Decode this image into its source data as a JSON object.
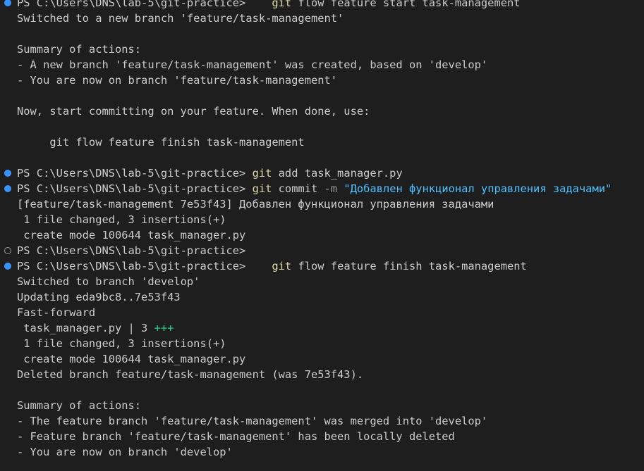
{
  "theme": {
    "background": "#1e1e1e",
    "text": "#cccccc",
    "command_color": "#dcdcaa",
    "string_color": "#4fc1ff",
    "success_dot": "#3794ff",
    "plus_color": "#23d18b"
  },
  "icons": {
    "success": "command-success-dot-icon",
    "empty": "command-empty-dot-icon"
  },
  "terminal": {
    "lines": [
      {
        "dot": "success",
        "prompt": "PS C:\\Users\\DNS\\lab-5\\git-practice> ",
        "gap": "   ",
        "cmd": "git",
        "args": " flow feature start task-management"
      },
      {
        "text": "Switched to a new branch 'feature/task-management'"
      },
      {
        "text": ""
      },
      {
        "text": "Summary of actions:"
      },
      {
        "text": "- A new branch 'feature/task-management' was created, based on 'develop'"
      },
      {
        "text": "- You are now on branch 'feature/task-management'"
      },
      {
        "text": ""
      },
      {
        "text": "Now, start committing on your feature. When done, use:"
      },
      {
        "text": ""
      },
      {
        "text": "     git flow feature finish task-management"
      },
      {
        "text": ""
      },
      {
        "dot": "success",
        "prompt": "PS C:\\Users\\DNS\\lab-5\\git-practice> ",
        "gap": "",
        "cmd": "git",
        "args": " add task_manager.py"
      },
      {
        "dot": "success",
        "prompt": "PS C:\\Users\\DNS\\lab-5\\git-practice> ",
        "gap": "",
        "cmd": "git",
        "args": " commit ",
        "flag": "-m",
        "str": " \"Добавлен функционал управления задачами\""
      },
      {
        "text": "[feature/task-management 7e53f43] Добавлен функционал управления задачами"
      },
      {
        "text": " 1 file changed, 3 insertions(+)"
      },
      {
        "text": " create mode 100644 task_manager.py"
      },
      {
        "dot": "empty",
        "prompt": "PS C:\\Users\\DNS\\lab-5\\git-practice>",
        "gap": "",
        "cmd": "",
        "args": ""
      },
      {
        "dot": "success",
        "prompt": "PS C:\\Users\\DNS\\lab-5\\git-practice> ",
        "gap": "   ",
        "cmd": "git",
        "args": " flow feature finish task-management"
      },
      {
        "text": "Switched to branch 'develop'"
      },
      {
        "text": "Updating eda9bc8..7e53f43"
      },
      {
        "text": "Fast-forward"
      },
      {
        "text": " task_manager.py | 3 ",
        "plus": "+++"
      },
      {
        "text": " 1 file changed, 3 insertions(+)"
      },
      {
        "text": " create mode 100644 task_manager.py"
      },
      {
        "text": "Deleted branch feature/task-management (was 7e53f43)."
      },
      {
        "text": ""
      },
      {
        "text": "Summary of actions:"
      },
      {
        "text": "- The feature branch 'feature/task-management' was merged into 'develop'"
      },
      {
        "text": "- Feature branch 'feature/task-management' has been locally deleted"
      },
      {
        "text": "- You are now on branch 'develop'"
      }
    ]
  }
}
